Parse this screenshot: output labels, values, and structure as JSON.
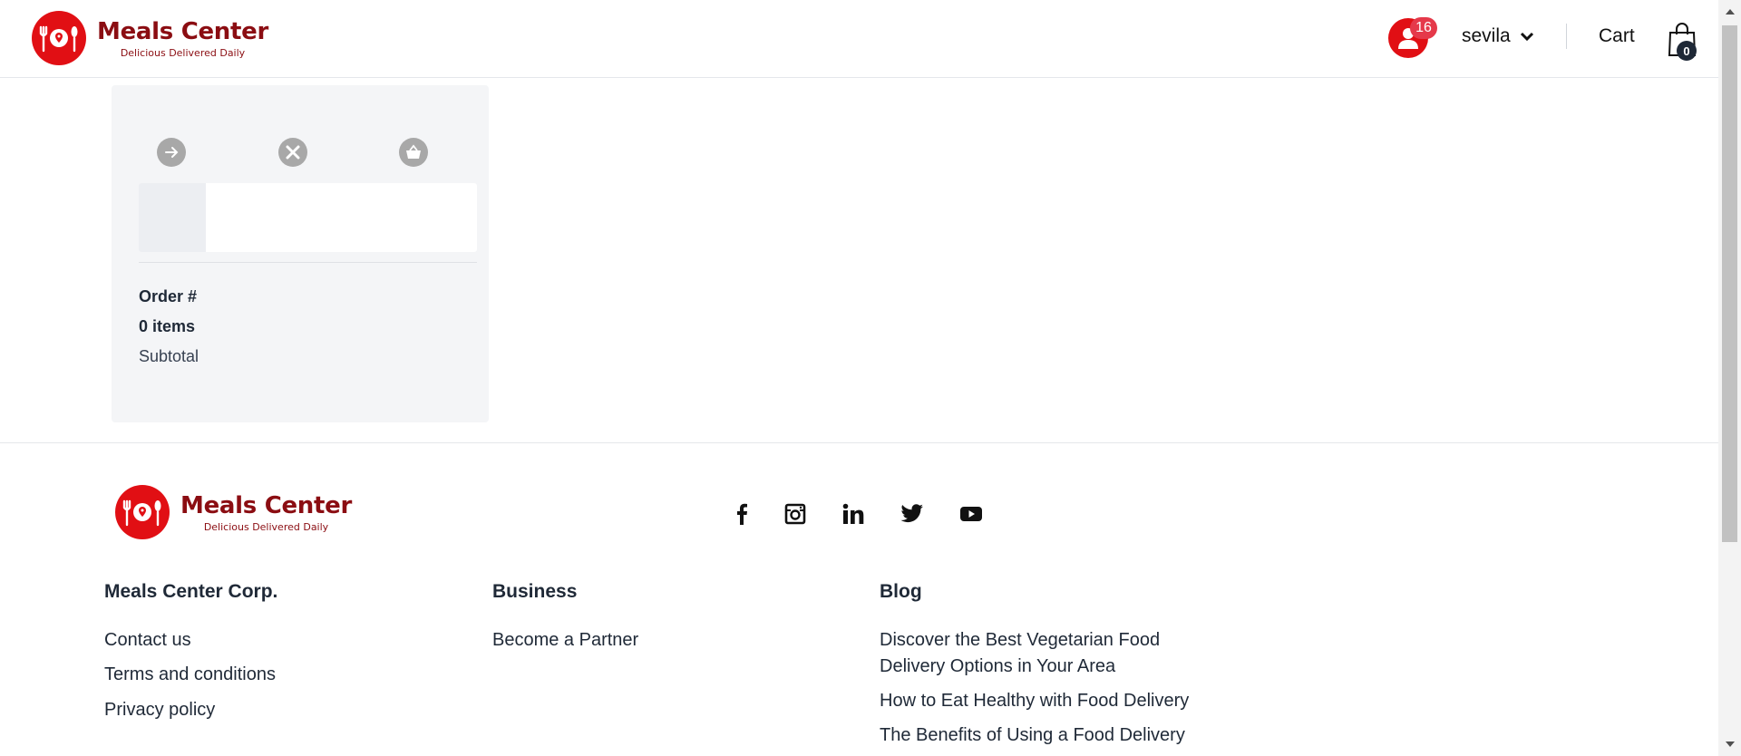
{
  "brand": {
    "name": "Meals Center",
    "tagline": "Delicious Delivered Daily",
    "color": "#e10f14",
    "dark_color": "#8b0d12"
  },
  "header": {
    "notification_count": "16",
    "username": "sevila",
    "cart_label": "Cart",
    "cart_count": "0"
  },
  "order": {
    "steps": [
      "arrow-right-icon",
      "utensils-icon",
      "basket-icon"
    ],
    "order_number_label": "Order #",
    "items_label": "0 items",
    "subtotal_label": "Subtotal"
  },
  "footer": {
    "social": [
      "facebook-icon",
      "instagram-icon",
      "linkedin-icon",
      "twitter-icon",
      "youtube-icon"
    ],
    "columns": [
      {
        "title": "Meals Center Corp.",
        "links": [
          "Contact us",
          "Terms and conditions",
          "Privacy policy"
        ]
      },
      {
        "title": "Business",
        "links": [
          "Become a Partner"
        ]
      },
      {
        "title": "Blog",
        "links": [
          "Discover the Best Vegetarian Food Delivery Options in Your Area",
          "How to Eat Healthy with Food Delivery",
          "The Benefits of Using a Food Delivery"
        ]
      }
    ]
  }
}
